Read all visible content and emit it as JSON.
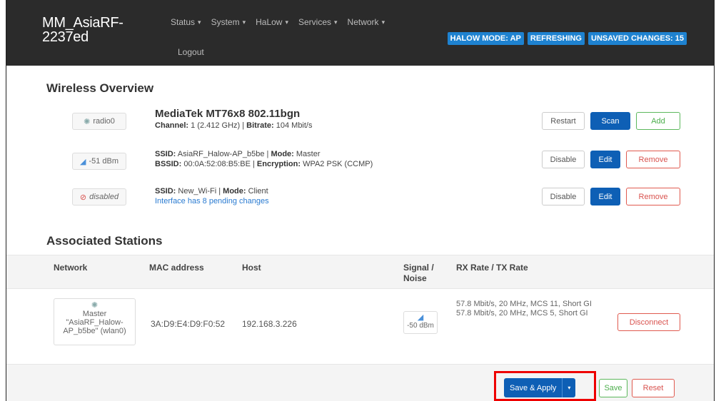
{
  "header": {
    "brand": "MM_AsiaRF-2237ed",
    "menu": [
      {
        "label": "Status"
      },
      {
        "label": "System"
      },
      {
        "label": "HaLow"
      },
      {
        "label": "Services"
      },
      {
        "label": "Network"
      }
    ],
    "logout": "Logout",
    "indicators": [
      "HALOW MODE: AP",
      "REFRESHING",
      "UNSAVED CHANGES: 15"
    ]
  },
  "wireless": {
    "heading": "Wireless Overview",
    "radio": {
      "badge": "radio0",
      "title": "MediaTek MT76x8 802.11bgn",
      "channel_label": "Channel:",
      "channel_value": " 1 (2.412 GHz) | ",
      "bitrate_label": "Bitrate:",
      "bitrate_value": " 104 Mbit/s",
      "restart": "Restart",
      "scan": "Scan",
      "add": "Add"
    },
    "networks": [
      {
        "badge": "-51 dBm",
        "ssid_label": "SSID:",
        "ssid": " AsiaRF_Halow-AP_b5be | ",
        "mode_label": "Mode:",
        "mode": " Master",
        "bssid_label": "BSSID:",
        "bssid": " 00:0A:52:08:B5:BE | ",
        "enc_label": "Encryption:",
        "enc": " WPA2 PSK (CCMP)",
        "disable": "Disable",
        "edit": "Edit",
        "remove": "Remove"
      },
      {
        "badge": "disabled",
        "ssid_label": "SSID:",
        "ssid": " New_Wi-Fi | ",
        "mode_label": "Mode:",
        "mode": " Client",
        "pending": "Interface has 8 pending changes",
        "disable": "Disable",
        "edit": "Edit",
        "remove": "Remove"
      }
    ]
  },
  "stations": {
    "heading": "Associated Stations",
    "columns": [
      "Network",
      "MAC address",
      "Host",
      "Signal / Noise",
      "RX Rate / TX Rate"
    ],
    "rows": [
      {
        "network_line1": "Master",
        "network_line2": "\"AsiaRF_Halow-",
        "network_line3": "AP_b5be\" (wlan0)",
        "mac": "3A:D9:E4:D9:F0:52",
        "host": "192.168.3.226",
        "signal": "-50 dBm",
        "rx": "57.8 Mbit/s, 20 MHz, MCS 11, Short GI",
        "tx": "57.8 Mbit/s, 20 MHz, MCS 5, Short GI",
        "disconnect": "Disconnect"
      }
    ]
  },
  "footer": {
    "save_apply": "Save & Apply",
    "save": "Save",
    "reset": "Reset"
  },
  "colors": {
    "navbar": "#2b2b2b",
    "primary": "#0e5fb5",
    "indicator": "#1e82d0",
    "danger": "#d9534f",
    "success": "#5cb85c",
    "highlight": "#ee0000"
  }
}
